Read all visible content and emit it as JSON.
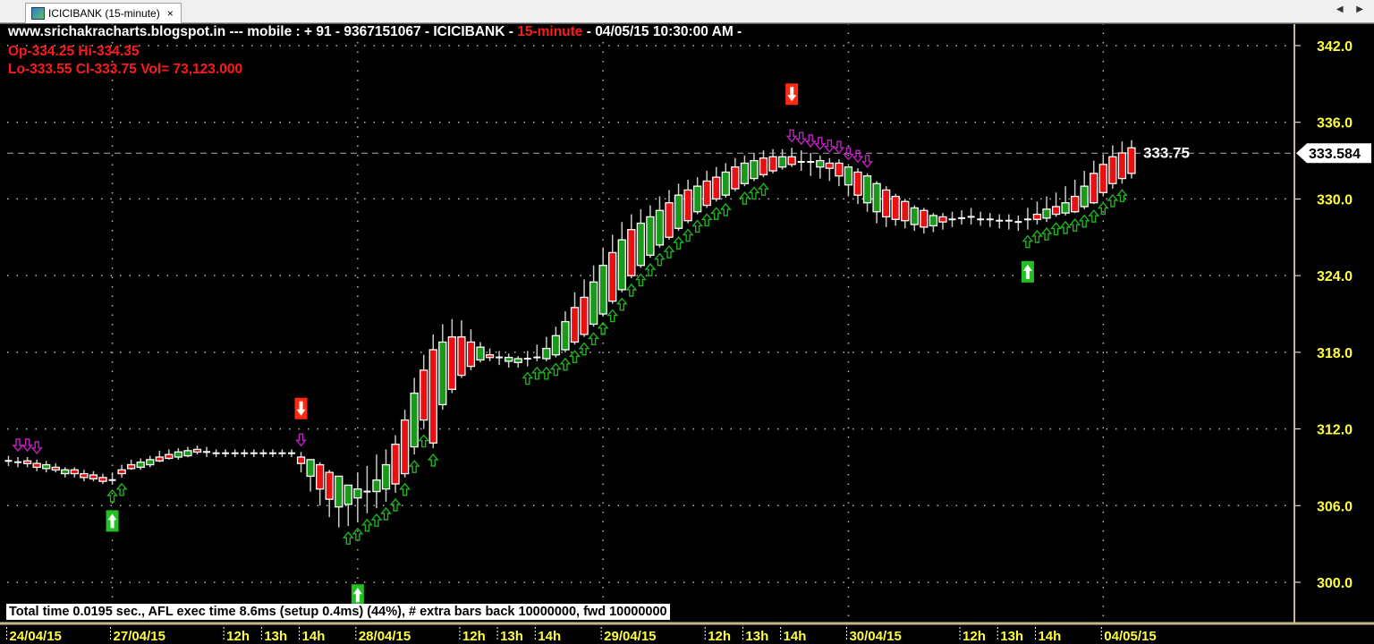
{
  "tab": {
    "title": "ICICIBANK (15-minute)",
    "close": "×",
    "nav_arrows": "◀ ▶"
  },
  "header": {
    "line1_prefix": "www.srichakracharts.blogspot.in ---  mobile :  + 91 - 9367151067 - ICICIBANK - ",
    "interval": "15-minute",
    "line1_suffix": "  - 04/05/15 10:30:00 AM -",
    "line2": "Op-334.25  Hi-334.35",
    "line3": "Lo-333.55  Cl-333.75  Vol= 73,123.000"
  },
  "info_bar": "Total time 0.0195 sec., AFL exec time 8.6ms (setup 0.4ms) (44%), # extra bars back 10000000, fwd 10000000",
  "colors": {
    "up": "#1a9a1a",
    "down": "#e81010",
    "outline": "#ffffff",
    "wick": "#c8c8c8",
    "axis_text": "#ffff40",
    "trail_down": "#c020c0",
    "trail_up": "#20b020",
    "buy": "#22c022",
    "sell": "#ff2a10"
  },
  "chart_data": {
    "type": "candlestick",
    "symbol": "ICICIBANK",
    "interval": "15-minute",
    "ylim": [
      297.5,
      343.5
    ],
    "yticks": [
      342.0,
      336.0,
      330.0,
      324.0,
      318.0,
      312.0,
      306.0,
      300.0
    ],
    "ytick_labels": [
      "342.0",
      "336.0",
      "330.0",
      "324.0",
      "318.0",
      "312.0",
      "306.0",
      "300.0"
    ],
    "grid": true,
    "xlabels": [
      {
        "bar": 0,
        "label": "24/04/15",
        "day": true
      },
      {
        "bar": 11,
        "label": "27/04/15",
        "day": true
      },
      {
        "bar": 23,
        "label": "12h"
      },
      {
        "bar": 27,
        "label": "13h"
      },
      {
        "bar": 31,
        "label": "14h"
      },
      {
        "bar": 37,
        "label": "28/04/15",
        "day": true
      },
      {
        "bar": 48,
        "label": "12h"
      },
      {
        "bar": 52,
        "label": "13h"
      },
      {
        "bar": 56,
        "label": "14h"
      },
      {
        "bar": 63,
        "label": "29/04/15",
        "day": true
      },
      {
        "bar": 74,
        "label": "12h"
      },
      {
        "bar": 78,
        "label": "13h"
      },
      {
        "bar": 82,
        "label": "14h"
      },
      {
        "bar": 89,
        "label": "30/04/15",
        "day": true
      },
      {
        "bar": 101,
        "label": "12h"
      },
      {
        "bar": 105,
        "label": "13h"
      },
      {
        "bar": 109,
        "label": "14h"
      },
      {
        "bar": 116,
        "label": "04/05/15",
        "day": true
      }
    ],
    "ohlc": [
      [
        309.5,
        309.9,
        309.1,
        309.5
      ],
      [
        309.4,
        309.8,
        309.0,
        309.4
      ],
      [
        309.5,
        309.8,
        309.0,
        309.3
      ],
      [
        309.3,
        309.6,
        308.7,
        309.0
      ],
      [
        308.9,
        309.5,
        308.6,
        309.2
      ],
      [
        309.0,
        309.3,
        308.6,
        308.8
      ],
      [
        308.5,
        309.0,
        308.2,
        308.8
      ],
      [
        308.8,
        309.0,
        308.2,
        308.5
      ],
      [
        308.5,
        308.8,
        307.9,
        308.2
      ],
      [
        308.4,
        308.7,
        307.9,
        308.1
      ],
      [
        308.2,
        308.5,
        307.7,
        307.9
      ],
      [
        308.0,
        308.6,
        307.7,
        308.0
      ],
      [
        308.8,
        309.2,
        308.2,
        308.5
      ],
      [
        309.2,
        309.6,
        308.8,
        308.9
      ],
      [
        309.0,
        309.7,
        308.8,
        309.4
      ],
      [
        309.2,
        309.9,
        309.0,
        309.6
      ],
      [
        309.8,
        310.3,
        309.4,
        309.5
      ],
      [
        310.0,
        310.4,
        309.6,
        309.7
      ],
      [
        309.8,
        310.5,
        309.6,
        310.2
      ],
      [
        309.9,
        310.6,
        309.8,
        310.3
      ],
      [
        310.4,
        310.7,
        310.0,
        310.2
      ],
      [
        310.2,
        310.6,
        309.8,
        310.2
      ],
      [
        310.1,
        310.4,
        309.8,
        310.1
      ],
      [
        310.1,
        310.4,
        309.8,
        310.1
      ],
      [
        310.1,
        310.4,
        309.8,
        310.1
      ],
      [
        310.1,
        310.4,
        309.8,
        310.1
      ],
      [
        310.1,
        310.4,
        309.8,
        310.1
      ],
      [
        310.1,
        310.4,
        309.8,
        310.1
      ],
      [
        310.1,
        310.4,
        309.8,
        310.1
      ],
      [
        310.1,
        310.4,
        309.8,
        310.1
      ],
      [
        310.1,
        310.4,
        309.8,
        310.1
      ],
      [
        309.8,
        310.2,
        308.6,
        309.3
      ],
      [
        308.3,
        309.6,
        307.1,
        309.6
      ],
      [
        309.2,
        309.4,
        306.0,
        307.3
      ],
      [
        308.6,
        308.8,
        305.1,
        306.5
      ],
      [
        305.9,
        308.3,
        304.3,
        308.3
      ],
      [
        306.1,
        307.6,
        304.4,
        307.6
      ],
      [
        306.6,
        308.6,
        304.7,
        307.3
      ],
      [
        307.1,
        309.1,
        305.4,
        307.1
      ],
      [
        307.1,
        310.0,
        305.8,
        308.0
      ],
      [
        307.3,
        310.4,
        306.3,
        309.2
      ],
      [
        310.8,
        311.5,
        307.0,
        307.7
      ],
      [
        312.7,
        313.5,
        308.2,
        308.5
      ],
      [
        310.6,
        316.0,
        310.0,
        314.8
      ],
      [
        316.6,
        317.8,
        312.0,
        312.7
      ],
      [
        318.2,
        319.4,
        310.5,
        310.9
      ],
      [
        313.9,
        320.2,
        313.5,
        318.8
      ],
      [
        319.2,
        320.6,
        314.8,
        315.1
      ],
      [
        319.2,
        320.5,
        316.0,
        316.2
      ],
      [
        318.8,
        319.8,
        316.6,
        316.9
      ],
      [
        317.4,
        318.8,
        317.2,
        318.4
      ],
      [
        317.8,
        318.3,
        317.3,
        317.6
      ],
      [
        317.6,
        318.1,
        317.0,
        317.6
      ],
      [
        317.3,
        317.9,
        316.8,
        317.6
      ],
      [
        317.2,
        317.7,
        316.8,
        317.5
      ],
      [
        317.5,
        318.1,
        316.9,
        317.5
      ],
      [
        317.6,
        318.6,
        317.3,
        317.6
      ],
      [
        317.5,
        319.2,
        317.3,
        318.3
      ],
      [
        317.8,
        320.0,
        317.6,
        319.3
      ],
      [
        318.2,
        321.2,
        318.0,
        320.4
      ],
      [
        321.5,
        322.7,
        318.6,
        318.8
      ],
      [
        322.3,
        323.7,
        319.2,
        319.4
      ],
      [
        320.2,
        324.8,
        320.0,
        323.5
      ],
      [
        321.0,
        326.2,
        320.8,
        324.8
      ],
      [
        325.8,
        327.2,
        321.8,
        322.0
      ],
      [
        322.9,
        328.2,
        322.7,
        326.8
      ],
      [
        327.6,
        328.8,
        323.8,
        324.0
      ],
      [
        324.8,
        329.2,
        324.6,
        328.1
      ],
      [
        325.6,
        329.5,
        325.4,
        328.6
      ],
      [
        326.4,
        330.2,
        326.2,
        329.1
      ],
      [
        329.7,
        330.7,
        326.8,
        327.0
      ],
      [
        327.7,
        331.2,
        327.5,
        330.3
      ],
      [
        330.7,
        331.5,
        328.1,
        328.3
      ],
      [
        329.0,
        331.7,
        328.8,
        331.0
      ],
      [
        331.4,
        332.2,
        329.3,
        329.5
      ],
      [
        331.7,
        332.5,
        329.8,
        330.0
      ],
      [
        330.3,
        332.8,
        330.1,
        332.1
      ],
      [
        332.5,
        333.2,
        330.6,
        330.8
      ],
      [
        331.2,
        333.4,
        331.0,
        332.8
      ],
      [
        331.6,
        333.6,
        331.4,
        333.0
      ],
      [
        333.2,
        333.8,
        331.7,
        331.9
      ],
      [
        333.3,
        333.9,
        332.0,
        332.2
      ],
      [
        332.5,
        333.9,
        332.3,
        333.3
      ],
      [
        333.3,
        334.0,
        332.5,
        332.7
      ],
      [
        332.9,
        333.8,
        332.2,
        332.9
      ],
      [
        332.9,
        333.6,
        331.8,
        332.9
      ],
      [
        332.5,
        333.4,
        331.6,
        333.0
      ],
      [
        332.8,
        333.2,
        331.4,
        332.4
      ],
      [
        332.8,
        333.1,
        331.0,
        331.8
      ],
      [
        331.1,
        332.6,
        330.2,
        332.5
      ],
      [
        332.1,
        332.4,
        329.6,
        330.3
      ],
      [
        329.7,
        332.0,
        329.0,
        331.8
      ],
      [
        329.0,
        331.4,
        328.1,
        331.2
      ],
      [
        330.7,
        331.0,
        327.8,
        328.6
      ],
      [
        330.2,
        330.4,
        327.9,
        328.4
      ],
      [
        329.8,
        330.0,
        327.7,
        328.3
      ],
      [
        328.0,
        329.5,
        327.5,
        329.3
      ],
      [
        329.1,
        329.3,
        327.3,
        327.8
      ],
      [
        327.9,
        328.9,
        327.4,
        328.7
      ],
      [
        328.6,
        328.9,
        327.6,
        328.2
      ],
      [
        328.4,
        329.0,
        327.8,
        328.4
      ],
      [
        328.5,
        329.1,
        328.0,
        328.5
      ],
      [
        328.6,
        329.3,
        328.0,
        328.6
      ],
      [
        328.4,
        329.0,
        327.9,
        328.4
      ],
      [
        328.4,
        328.9,
        327.8,
        328.4
      ],
      [
        328.3,
        328.8,
        327.7,
        328.3
      ],
      [
        328.3,
        328.8,
        327.6,
        328.3
      ],
      [
        328.2,
        328.7,
        327.5,
        328.2
      ],
      [
        328.4,
        329.3,
        327.6,
        328.4
      ],
      [
        328.8,
        329.8,
        328.0,
        328.4
      ],
      [
        328.5,
        330.2,
        328.2,
        329.2
      ],
      [
        329.4,
        330.5,
        328.6,
        328.8
      ],
      [
        328.9,
        331.0,
        328.7,
        329.7
      ],
      [
        330.2,
        331.5,
        328.9,
        329.0
      ],
      [
        329.4,
        332.2,
        329.2,
        331.0
      ],
      [
        332.0,
        333.0,
        329.6,
        329.7
      ],
      [
        332.7,
        333.5,
        330.2,
        330.5
      ],
      [
        333.3,
        334.2,
        330.8,
        331.2
      ],
      [
        333.6,
        334.5,
        331.2,
        331.6
      ],
      [
        334.0,
        334.6,
        331.6,
        332.0
      ]
    ],
    "buy_signals": [
      {
        "bar": 11,
        "price": 304.8
      },
      {
        "bar": 37,
        "price": 299.0
      },
      {
        "bar": 108,
        "price": 324.3
      }
    ],
    "sell_signals": [
      {
        "bar": 31,
        "price": 313.6
      },
      {
        "bar": 83,
        "price": 338.2
      }
    ],
    "trail_down_bars": [
      1,
      2,
      3,
      31,
      83,
      84,
      85,
      86,
      87,
      88,
      89,
      90,
      91
    ],
    "trail_up_bars": [
      11,
      12,
      36,
      37,
      38,
      39,
      40,
      41,
      42,
      43,
      44,
      45,
      55,
      56,
      57,
      58,
      59,
      60,
      61,
      62,
      63,
      64,
      65,
      66,
      67,
      68,
      69,
      70,
      71,
      72,
      73,
      74,
      75,
      76,
      78,
      79,
      80,
      108,
      109,
      110,
      111,
      112,
      113,
      114,
      115,
      116,
      117,
      118
    ],
    "reference_line": {
      "value": 333.584,
      "label": "333.584"
    },
    "last_close_label": "333.75"
  }
}
